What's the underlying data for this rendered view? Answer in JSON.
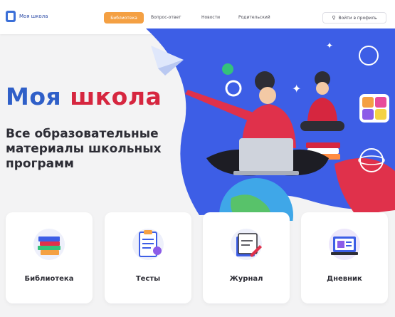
{
  "header": {
    "logo_text": "Моя школа",
    "nav_button": "Библиотека",
    "links": [
      "Вопрос-ответ",
      "Новости",
      "Родительский"
    ],
    "login_label": "Войти в профиль"
  },
  "hero": {
    "title_part1": "Моя",
    "title_part2": "школа",
    "subtitle_line1": "Все образовательные",
    "subtitle_line2": "материалы школьных",
    "subtitle_line3": "программ"
  },
  "cards": [
    {
      "label": "Библиотека",
      "icon": "library-icon"
    },
    {
      "label": "Тесты",
      "icon": "tests-icon"
    },
    {
      "label": "Журнал",
      "icon": "journal-icon"
    },
    {
      "label": "Дневник",
      "icon": "diary-icon"
    }
  ],
  "colors": {
    "brand_blue": "#2f5fc8",
    "brand_red": "#d6263f",
    "accent_orange": "#f4a043"
  }
}
